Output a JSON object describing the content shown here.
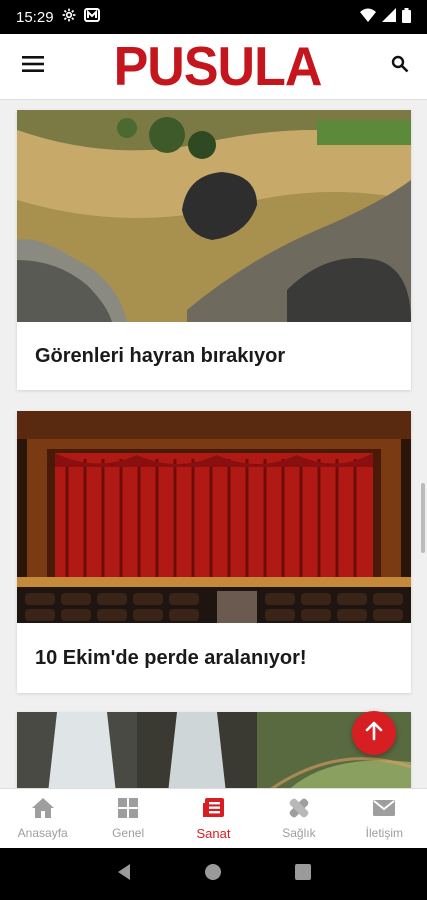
{
  "status_bar": {
    "time": "15:29"
  },
  "app_bar": {
    "logo_text": "PUSULA"
  },
  "feed": {
    "cards": [
      {
        "title": "Görenleri hayran bırakıyor"
      },
      {
        "title": "10 Ekim'de perde aralanıyor!"
      },
      {
        "title": ""
      }
    ]
  },
  "bottom_nav": {
    "items": [
      {
        "label": "Anasayfa",
        "icon": "home-icon"
      },
      {
        "label": "Genel",
        "icon": "grid-icon"
      },
      {
        "label": "Sanat",
        "icon": "newspaper-icon",
        "active": true
      },
      {
        "label": "Sağlık",
        "icon": "bandage-icon"
      },
      {
        "label": "İletişim",
        "icon": "mail-icon"
      }
    ]
  },
  "colors": {
    "brand": "#c4161c",
    "accent": "#d71e22"
  }
}
